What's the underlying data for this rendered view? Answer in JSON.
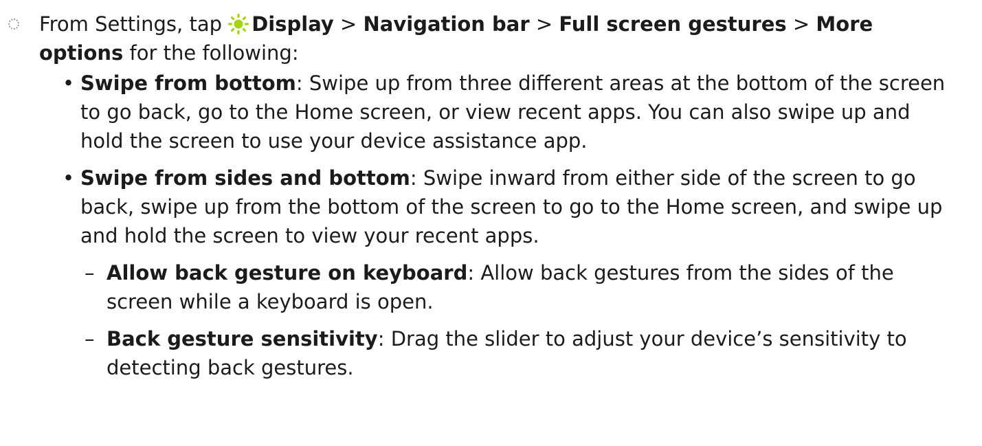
{
  "step": {
    "intro": "From Settings, tap ",
    "icon": "display-sun-icon",
    "icon_color": "#a3d40f",
    "path_display": "Display",
    "sep1": " > ",
    "path_nav_bar": "Navigation bar",
    "sep2": " > ",
    "path_full_screen": "Full screen gestures",
    "sep3": " > ",
    "path_more_options": "More options",
    "tail": " for the following:"
  },
  "bullets": [
    {
      "term": "Swipe from bottom",
      "desc": ": Swipe up from three different areas at the bottom of the screen to go back, go to the Home screen, or view recent apps. You can also swipe up and hold the screen to use your device assistance app."
    },
    {
      "term": "Swipe from sides and bottom",
      "desc": ": Swipe inward from either side of the screen to go back, swipe up from the bottom of the screen to go to the Home screen, and swipe up and hold the screen to view your recent apps."
    }
  ],
  "sub_bullets": [
    {
      "term": "Allow back gesture on keyboard",
      "desc": ": Allow back gestures from the sides of the screen while a keyboard is open."
    },
    {
      "term": "Back gesture sensitivity",
      "desc": ": Drag the slider to adjust your device’s sensitivity to detecting back gestures."
    }
  ],
  "bullet_symbol": "•",
  "dash_symbol": "–"
}
